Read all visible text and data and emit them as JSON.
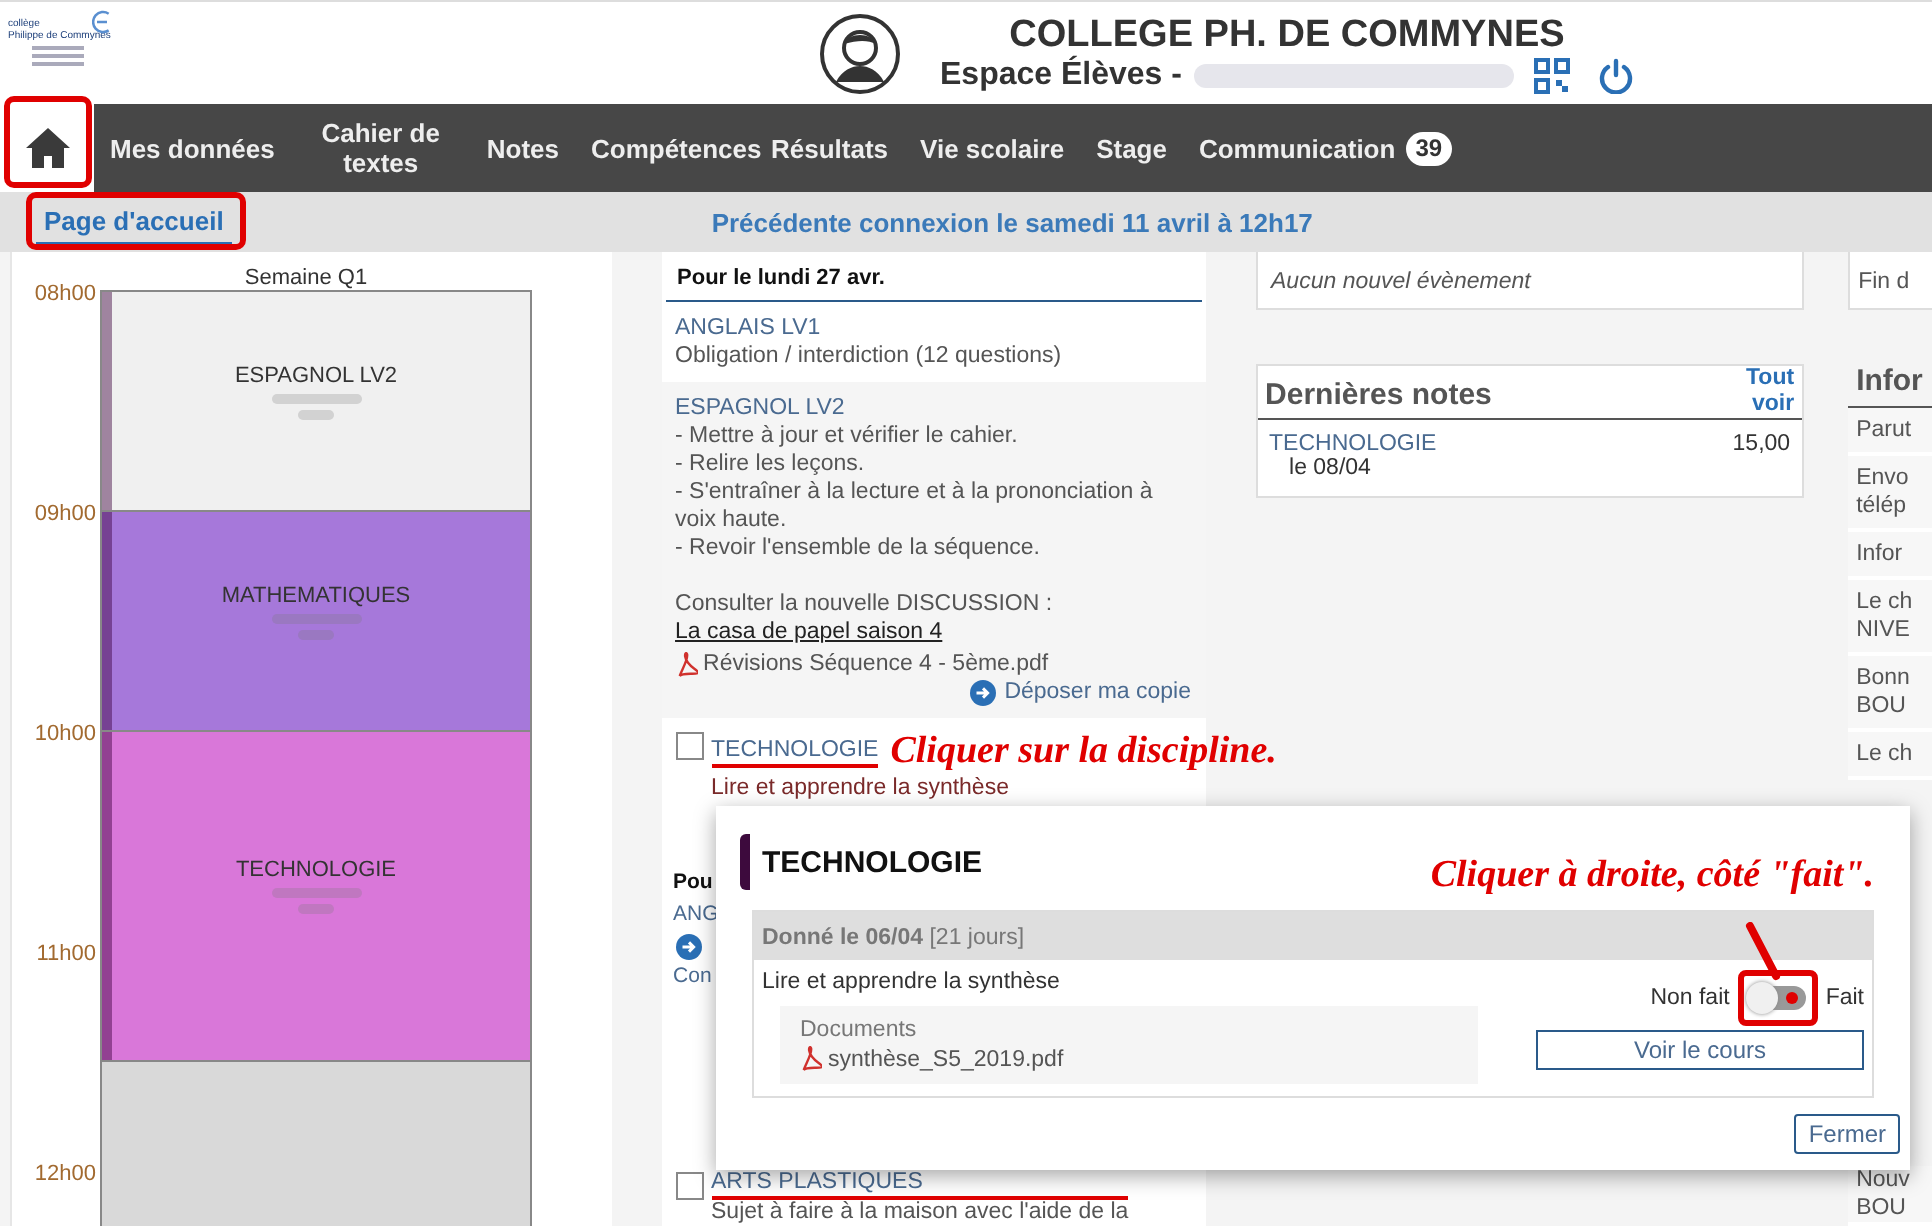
{
  "header": {
    "logo_lines": [
      "collège",
      "Philippe de Commynes"
    ],
    "school": "COLLEGE PH. DE COMMYNES",
    "space": "Espace Élèves -"
  },
  "nav": {
    "home": {
      "selected": true
    },
    "items": [
      {
        "label": "Mes données",
        "selected": false
      },
      {
        "label": "Cahier de textes",
        "selected": false
      },
      {
        "label": "Notes",
        "selected": false
      },
      {
        "label": "Compétences",
        "selected": false
      },
      {
        "label": "Résultats",
        "selected": false
      },
      {
        "label": "Vie scolaire",
        "selected": false
      },
      {
        "label": "Stage",
        "selected": false
      },
      {
        "label": "Communication",
        "selected": false,
        "badge": "39"
      }
    ]
  },
  "subbar": {
    "tabs": [
      {
        "label": "Page d'accueil",
        "selected": true
      }
    ],
    "last_login": "Précédente connexion le samedi 11 avril à 12h17"
  },
  "timetable": {
    "title": "Semaine Q1",
    "hours": [
      "08h00",
      "09h00",
      "10h00",
      "11h00",
      "12h00"
    ],
    "courses": [
      {
        "kind": "short",
        "subject": "ESPAGNOL LV2",
        "color": "#f0f0f0"
      },
      {
        "kind": "short",
        "subject": "MATHEMATIQUES",
        "color": "#a678da"
      },
      {
        "kind": "long",
        "subject": "TECHNOLOGIE",
        "color": "#d977d9"
      }
    ]
  },
  "homework": {
    "heading": "Pour le lundi 27 avr.",
    "items": [
      {
        "kind": "plain",
        "subject": "ANGLAIS LV1",
        "lines": [
          "Obligation / interdiction (12 questions)"
        ]
      },
      {
        "kind": "detailed",
        "subject": "ESPAGNOL LV2",
        "lines": [
          "- Mettre à jour et vérifier le cahier.",
          "- Relire les leçons.",
          "- S'entraîner à la lecture et à la prononciation à voix haute.",
          "- Revoir l'ensemble de la séquence."
        ],
        "discussion": "Consulter la nouvelle DISCUSSION :",
        "link": "La casa de papel saison 4",
        "file": "Révisions Séquence 4 - 5ème.pdf",
        "action": "Déposer ma copie"
      },
      {
        "kind": "checkable",
        "subject": "TECHNOLOGIE",
        "checked": false,
        "lines": [
          "Lire et apprendre la synthèse"
        ]
      }
    ],
    "next_heading": "Pou",
    "fragments": [
      "ANG",
      "Con"
    ],
    "last": {
      "subject": "ARTS PLASTIQUES",
      "checked": false,
      "text": "Sujet à faire à la maison avec l'aide de la"
    }
  },
  "events": {
    "text": "Aucun nouvel évènement"
  },
  "notes": {
    "title": "Dernières notes",
    "see_all": "Tout voir",
    "rows": [
      {
        "subject": "TECHNOLOGIE",
        "date": "le 08/04",
        "grade": "15,00"
      }
    ]
  },
  "info": {
    "top": "Fin d",
    "title": "Infor",
    "items": [
      {
        "lines": [
          "Parut"
        ]
      },
      {
        "lines": [
          "Envo",
          "télép"
        ]
      },
      {
        "lines": [
          "Infor"
        ]
      },
      {
        "lines": [
          "Le ch",
          "NIVE"
        ]
      },
      {
        "lines": [
          "Bonn",
          "BOU"
        ]
      },
      {
        "lines": [
          "Le ch"
        ]
      }
    ],
    "bottom": {
      "lines": [
        "Nouv",
        "BOU"
      ]
    }
  },
  "modal": {
    "title": "TECHNOLOGIE",
    "given": "**Donné le 06/04** [21 jours]",
    "task": "Lire et apprendre la synthèse",
    "not_done_label": "Non fait",
    "done_label": "Fait",
    "done": false,
    "documents_label": "Documents",
    "file": "synthèse_S5_2019.pdf",
    "view_button": "Voir le cours",
    "close_button": "Fermer"
  },
  "annotations": [
    "Cliquer sur la discipline.",
    "Cliquer à droite, côté \"fait\"."
  ]
}
